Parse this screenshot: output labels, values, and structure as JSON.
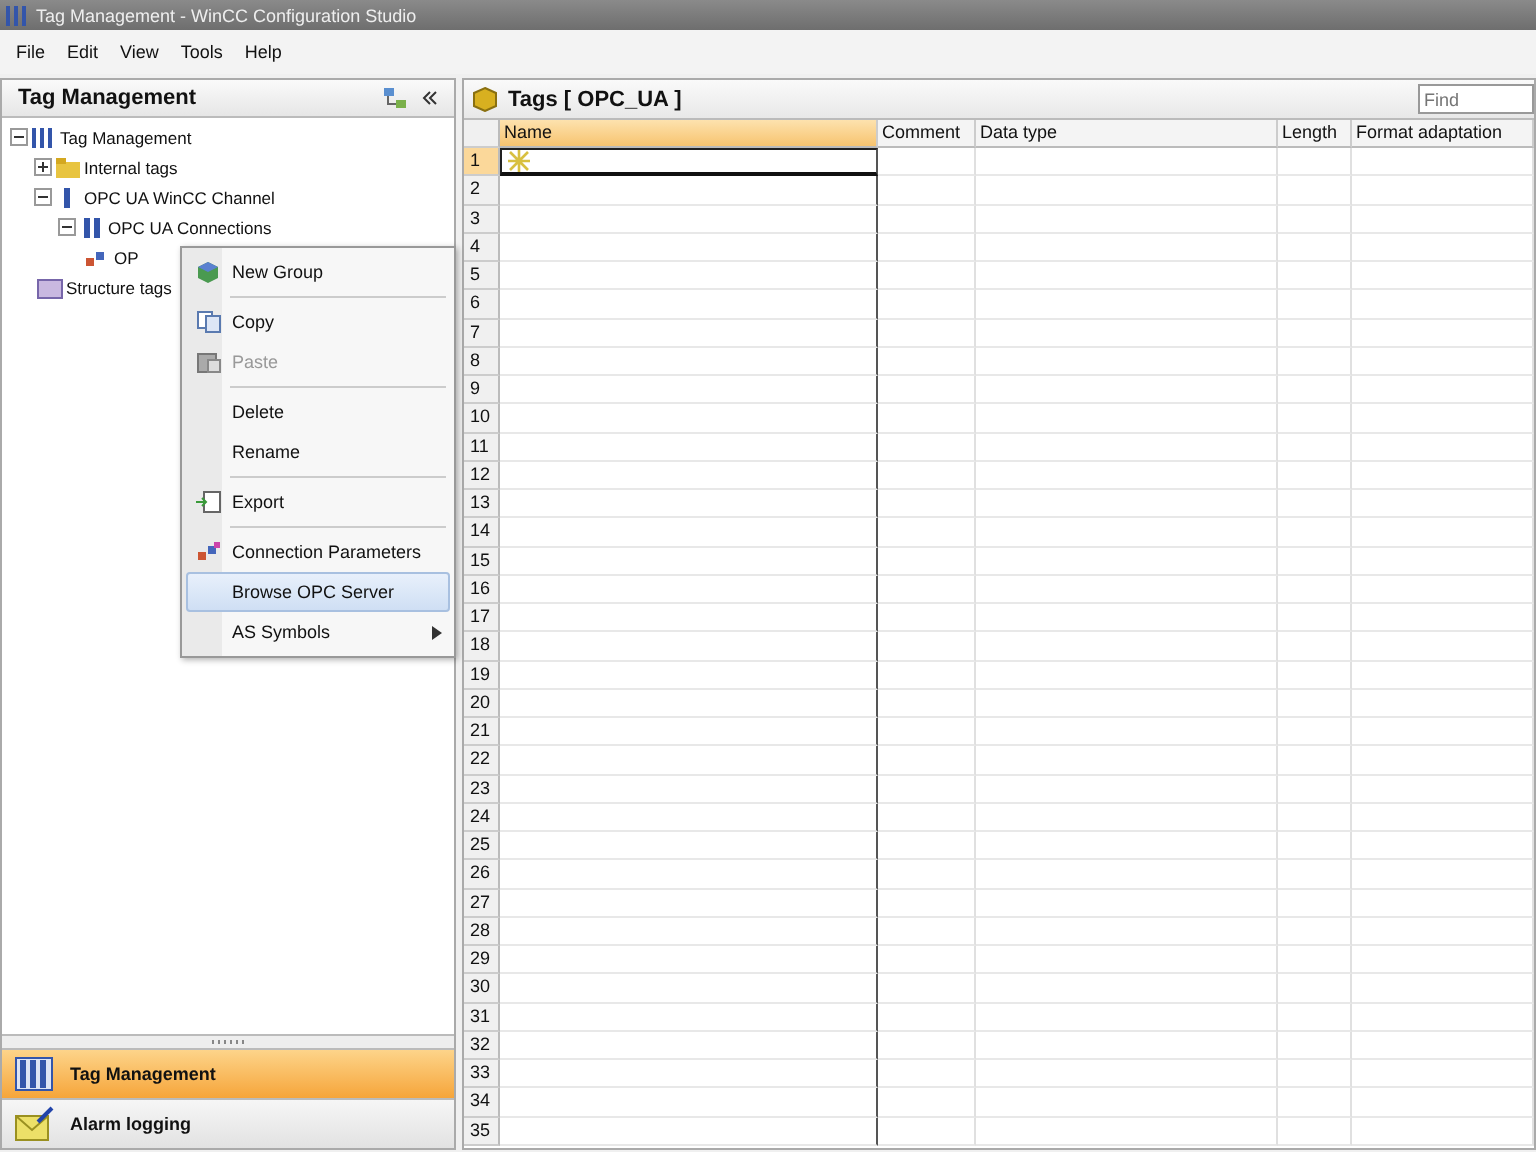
{
  "window": {
    "title": "Tag Management - WinCC Configuration Studio"
  },
  "menu": [
    "File",
    "Edit",
    "View",
    "Tools",
    "Help"
  ],
  "navigation": {
    "title": "Tag Management",
    "tree": [
      {
        "label": "Tag Management",
        "kind": "root",
        "expanded": true,
        "children": [
          {
            "label": "Internal tags",
            "kind": "folder",
            "expanded": false
          },
          {
            "label": "OPC UA WinCC Channel",
            "kind": "channel",
            "expanded": true,
            "children": [
              {
                "label": "OPC UA Connections",
                "kind": "connections",
                "expanded": true,
                "children": [
                  {
                    "label": "OP",
                    "kind": "connection"
                  }
                ]
              }
            ]
          },
          {
            "label": "Structure tags",
            "kind": "structure"
          }
        ]
      }
    ],
    "modules": [
      {
        "label": "Tag Management",
        "kind": "tags",
        "selected": true
      },
      {
        "label": "Alarm logging",
        "kind": "alarms",
        "selected": false
      }
    ]
  },
  "editor": {
    "title": "Tags [ OPC_UA ]",
    "search": {
      "placeholder": "Find"
    },
    "columns": [
      "Name",
      "Comment",
      "Data type",
      "Length",
      "Format adaptation"
    ],
    "rows": [
      {
        "number": "1",
        "selected": true
      },
      {
        "number": "2",
        "selected": false
      },
      {
        "number": "3",
        "selected": false
      },
      {
        "number": "4",
        "selected": false
      },
      {
        "number": "5",
        "selected": false
      },
      {
        "number": "6",
        "selected": false
      },
      {
        "number": "7",
        "selected": false
      },
      {
        "number": "8",
        "selected": false
      },
      {
        "number": "9",
        "selected": false
      },
      {
        "number": "10",
        "selected": false
      },
      {
        "number": "11",
        "selected": false
      },
      {
        "number": "12",
        "selected": false
      },
      {
        "number": "13",
        "selected": false
      },
      {
        "number": "14",
        "selected": false
      },
      {
        "number": "15",
        "selected": false
      },
      {
        "number": "16",
        "selected": false
      },
      {
        "number": "17",
        "selected": false
      },
      {
        "number": "18",
        "selected": false
      },
      {
        "number": "19",
        "selected": false
      },
      {
        "number": "20",
        "selected": false
      },
      {
        "number": "21",
        "selected": false
      },
      {
        "number": "22",
        "selected": false
      },
      {
        "number": "23",
        "selected": false
      },
      {
        "number": "24",
        "selected": false
      },
      {
        "number": "25",
        "selected": false
      },
      {
        "number": "26",
        "selected": false
      },
      {
        "number": "27",
        "selected": false
      },
      {
        "number": "28",
        "selected": false
      },
      {
        "number": "29",
        "selected": false
      },
      {
        "number": "30",
        "selected": false
      },
      {
        "number": "31",
        "selected": false
      },
      {
        "number": "32",
        "selected": false
      },
      {
        "number": "33",
        "selected": false
      },
      {
        "number": "34",
        "selected": false
      },
      {
        "number": "35",
        "selected": false
      }
    ]
  },
  "context_menu": {
    "items": [
      {
        "kind": "group",
        "label": "New Group",
        "disabled": false,
        "selected": false
      },
      {
        "kind": "separator"
      },
      {
        "kind": "copy",
        "label": "Copy",
        "disabled": false,
        "selected": false
      },
      {
        "kind": "paste",
        "label": "Paste",
        "disabled": true,
        "selected": false
      },
      {
        "kind": "separator"
      },
      {
        "kind": "plain",
        "label": "Delete",
        "disabled": false,
        "selected": false
      },
      {
        "kind": "plain",
        "label": "Rename",
        "disabled": false,
        "selected": false
      },
      {
        "kind": "separator"
      },
      {
        "kind": "export",
        "label": "Export",
        "disabled": false,
        "selected": false
      },
      {
        "kind": "separator"
      },
      {
        "kind": "parameters",
        "label": "Connection Parameters",
        "disabled": false,
        "selected": false
      },
      {
        "kind": "plain",
        "label": "Browse OPC Server",
        "disabled": false,
        "selected": true
      },
      {
        "kind": "submenu",
        "label": "AS Symbols",
        "disabled": false,
        "selected": false
      }
    ]
  }
}
